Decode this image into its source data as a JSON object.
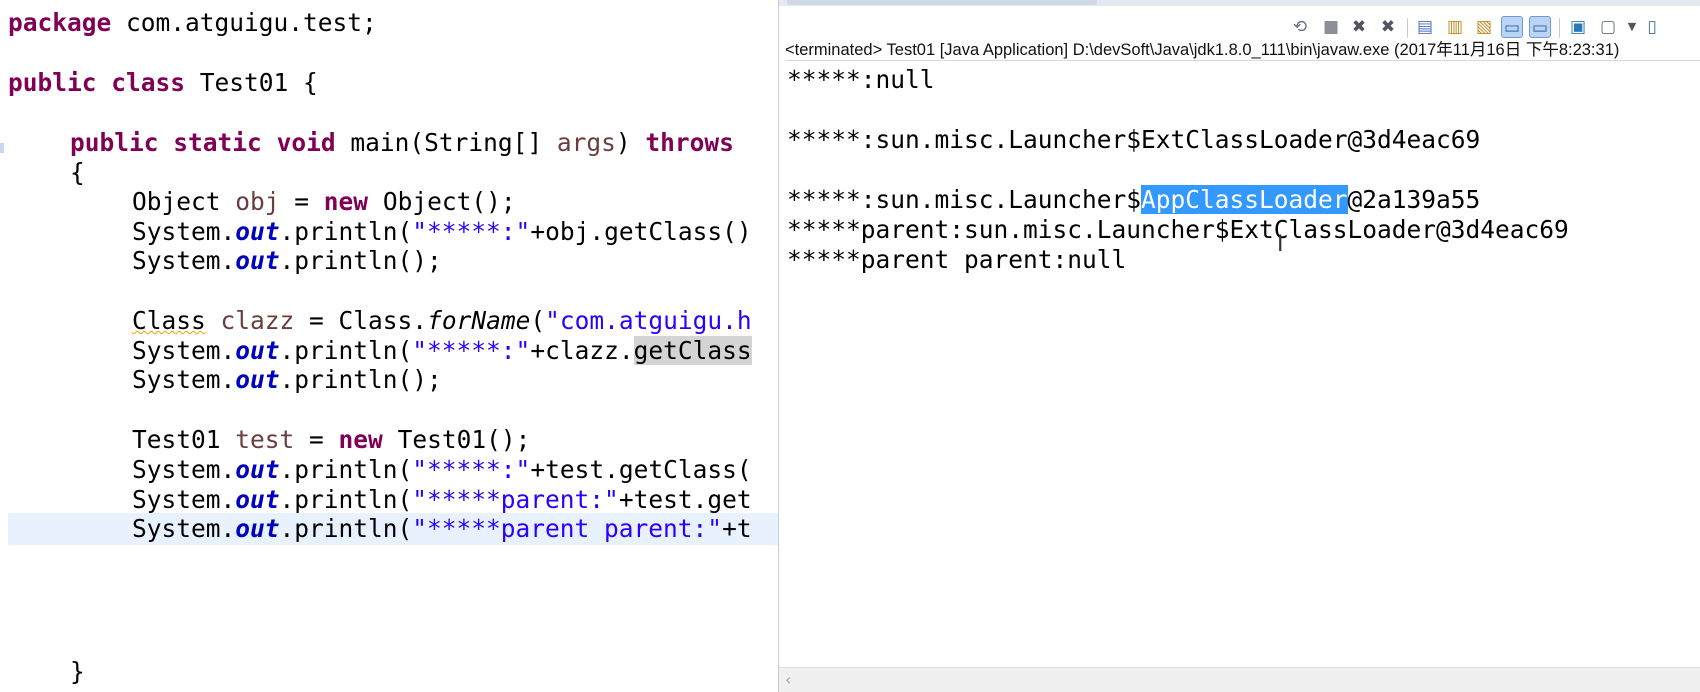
{
  "editor": {
    "line1": {
      "kw": "package",
      "rest": " com.atguigu.test;"
    },
    "line2": {
      "kw1": "public",
      "kw2": "class",
      "rest": " Test01 {"
    },
    "line3": {
      "kw1": "public",
      "kw2": "static",
      "kw3": "void",
      "mid": " main(String[] ",
      "var": "args",
      "paren": ") ",
      "kw4": "throws"
    },
    "line4": {
      "text": "{"
    },
    "line5": {
      "a": "Object ",
      "var": "obj",
      "b": " = ",
      "kw": "new",
      "c": " Object();"
    },
    "line6": {
      "a": "System.",
      "fld": "out",
      "b": ".println(",
      "str": "\"*****:\"",
      "c": "+obj.getClass()"
    },
    "line7": {
      "a": "System.",
      "fld": "out",
      "b": ".println();"
    },
    "line8": {
      "type": "Class",
      "sp": " ",
      "var": "clazz",
      "b": " = Class.",
      "method": "forName",
      "c": "(",
      "str": "\"com.atguigu.h"
    },
    "line9": {
      "a": "System.",
      "fld": "out",
      "b": ".println(",
      "str": "\"*****:\"",
      "c": "+clazz.",
      "occ": "getClass"
    },
    "line10": {
      "a": "System.",
      "fld": "out",
      "b": ".println();"
    },
    "line11": {
      "a": "Test01 ",
      "var": "test",
      "b": " = ",
      "kw": "new",
      "c": " Test01();"
    },
    "line12": {
      "a": "System.",
      "fld": "out",
      "b": ".println(",
      "str": "\"*****:\"",
      "c": "+test.getClass("
    },
    "line13": {
      "a": "System.",
      "fld": "out",
      "b": ".println(",
      "str": "\"*****parent:\"",
      "c": "+test.get"
    },
    "line14": {
      "a": "System.",
      "fld": "out",
      "b": ".println(",
      "str": "\"*****parent parent:\"",
      "c": "+t"
    },
    "line15": {
      "text": "}"
    }
  },
  "console": {
    "process_label": "<terminated> Test01 [Java Application] D:\\devSoft\\Java\\jdk1.8.0_111\\bin\\javaw.exe (2017年11月16日 下午8:23:31)",
    "out1": "*****:null",
    "out2": "*****:sun.misc.Launcher$ExtClassLoader@3d4eac69",
    "out3_pre": "*****:sun.misc.Launcher$",
    "out3_sel": "AppClassLoader",
    "out3_post": "@2a139a55",
    "out4": "*****parent:sun.misc.Launcher$ExtClassLoader@3d4eac69",
    "out5": "*****parent parent:null"
  },
  "toolbar": {
    "icons": [
      "sync-icon",
      "terminate-icon",
      "remove-launch-icon",
      "remove-all-terminated-icon",
      "scroll-lock-icon",
      "word-wrap-icon",
      "pin-console-icon",
      "show-on-stdout-icon",
      "show-on-stderr-icon",
      "open-console-icon",
      "display-console-icon",
      "view-menu-icon",
      "minimize-icon"
    ]
  },
  "colors": {
    "selection": "#3399ff",
    "keyword": "#7f0055",
    "string": "#2a00ff",
    "field": "#0000c0"
  }
}
